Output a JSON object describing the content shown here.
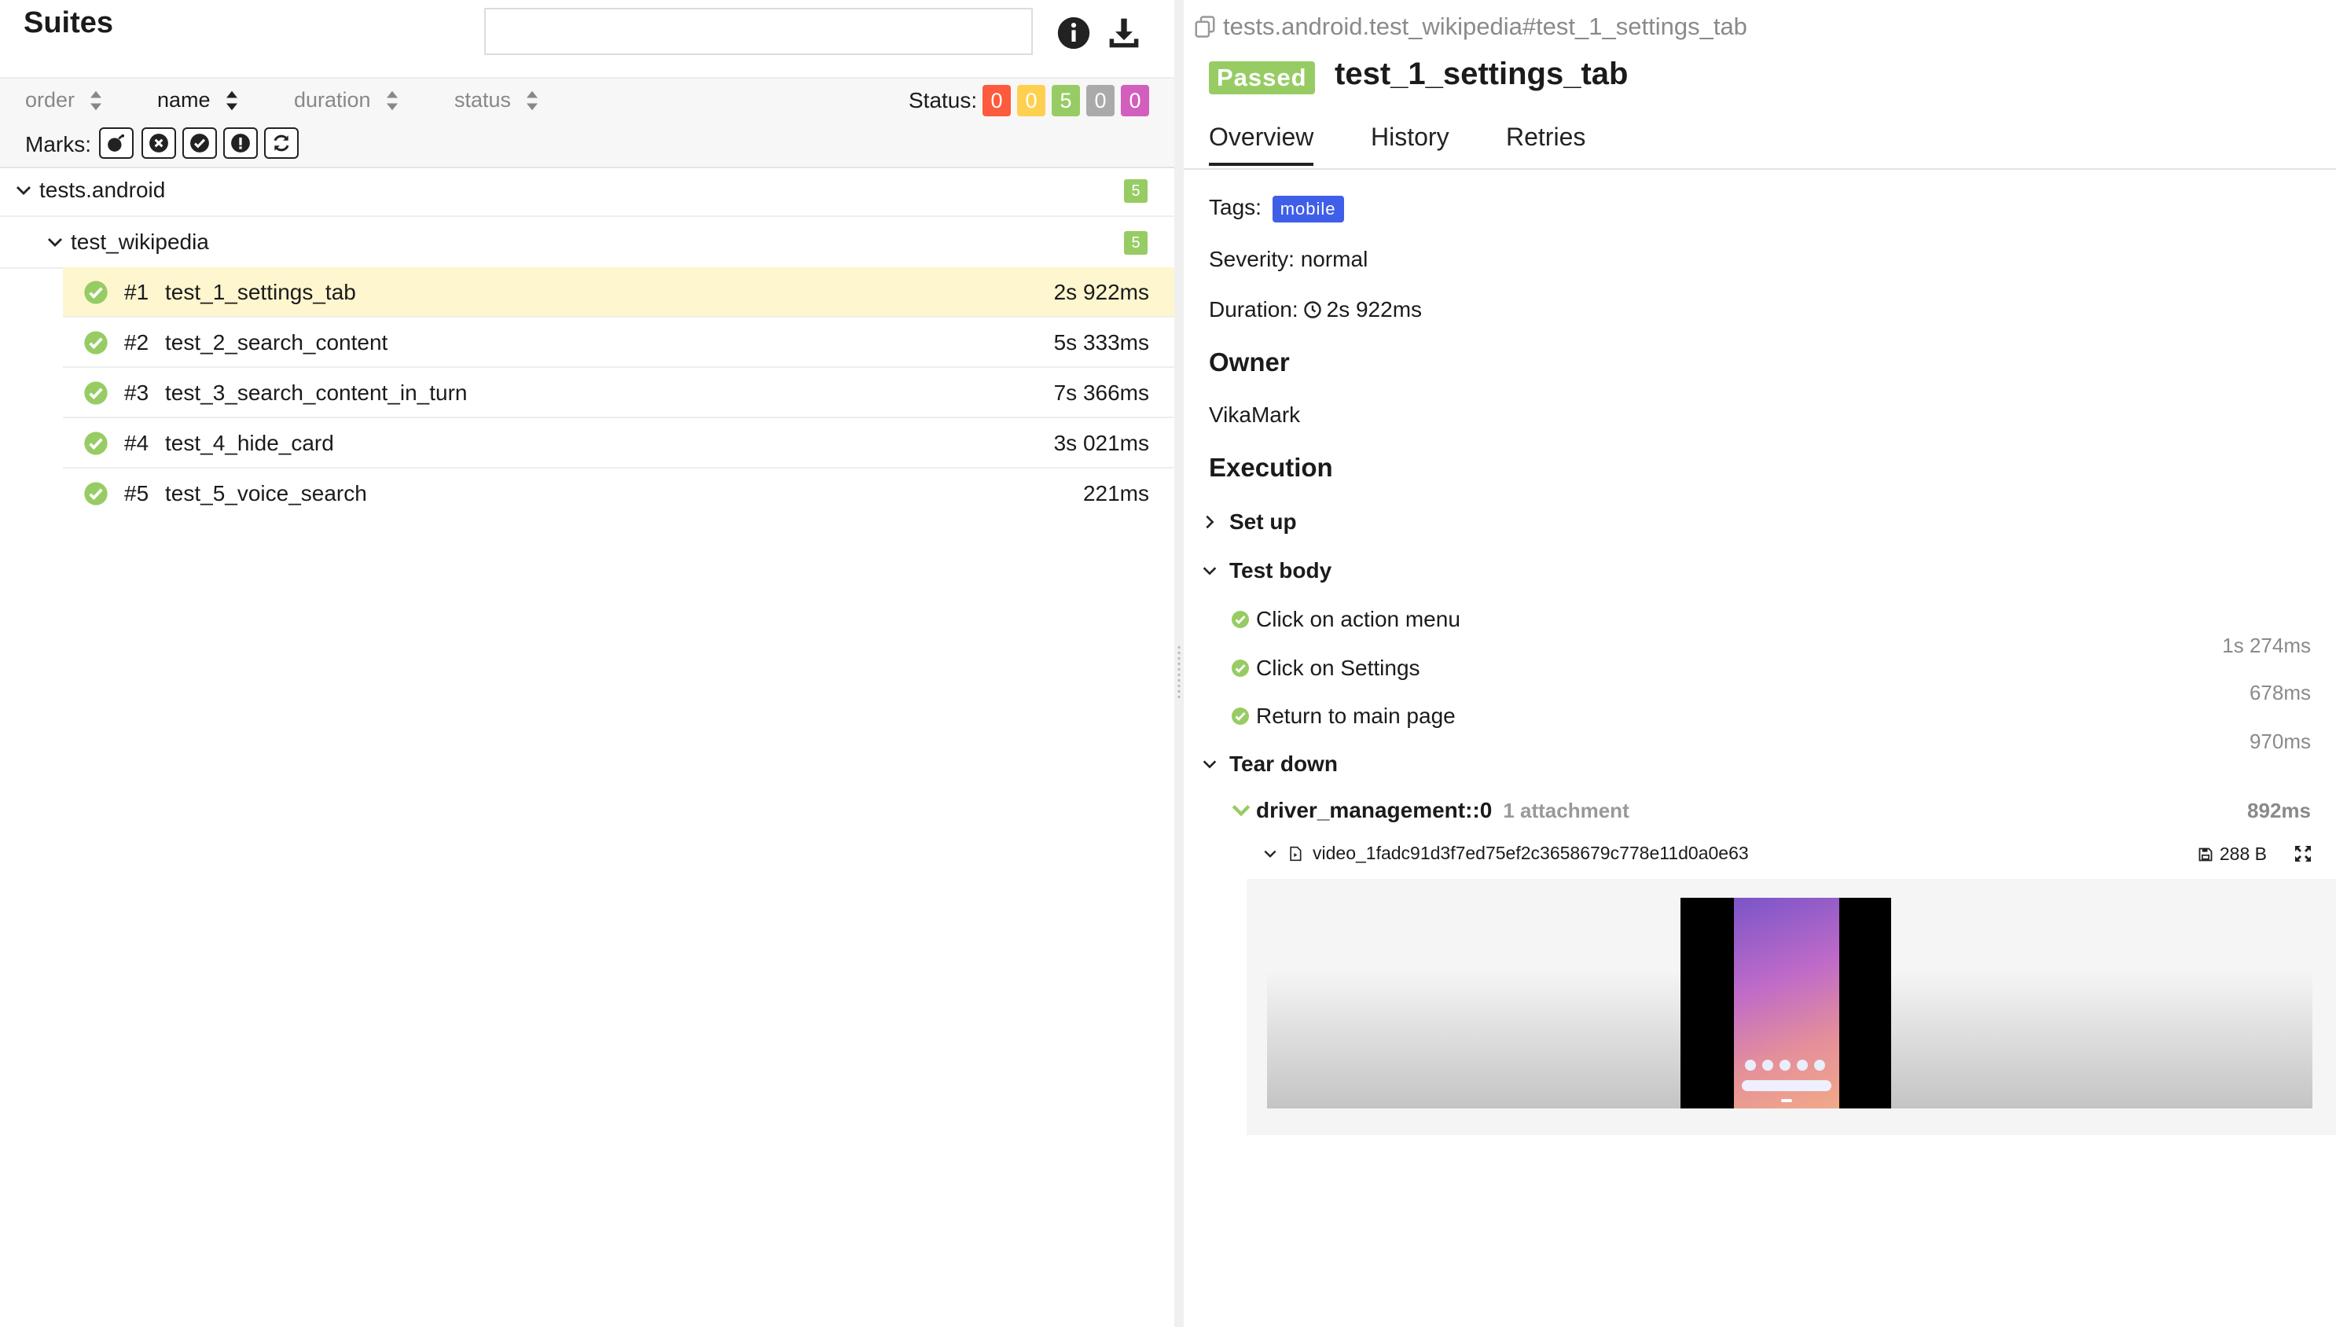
{
  "left": {
    "title": "Suites",
    "search_placeholder": "",
    "sort": {
      "order": "order",
      "name": "name",
      "duration": "duration",
      "status": "status"
    },
    "status_label": "Status:",
    "status_counts": [
      {
        "value": "0",
        "color": "#fd5a3e"
      },
      {
        "value": "0",
        "color": "#ffd050"
      },
      {
        "value": "5",
        "color": "#97cc64"
      },
      {
        "value": "0",
        "color": "#aaaaaa"
      },
      {
        "value": "0",
        "color": "#d35ebe"
      }
    ],
    "marks_label": "Marks:",
    "tree": {
      "root": {
        "name": "tests.android",
        "count": "5"
      },
      "group": {
        "name": "test_wikipedia",
        "count": "5"
      },
      "tests": [
        {
          "num": "#1",
          "name": "test_1_settings_tab",
          "duration": "2s 922ms"
        },
        {
          "num": "#2",
          "name": "test_2_search_content",
          "duration": "5s 333ms"
        },
        {
          "num": "#3",
          "name": "test_3_search_content_in_turn",
          "duration": "7s 366ms"
        },
        {
          "num": "#4",
          "name": "test_4_hide_card",
          "duration": "3s 021ms"
        },
        {
          "num": "#5",
          "name": "test_5_voice_search",
          "duration": "221ms"
        }
      ]
    }
  },
  "right": {
    "breadcrumb": "tests.android.test_wikipedia#test_1_settings_tab",
    "status_badge": "Passed",
    "test_title": "test_1_settings_tab",
    "tabs": [
      "Overview",
      "History",
      "Retries"
    ],
    "tags_label": "Tags:",
    "tag": "mobile",
    "severity": "Severity: normal",
    "duration_label": "Duration:",
    "duration_value": "2s 922ms",
    "owner_heading": "Owner",
    "owner": "VikaMark",
    "execution_heading": "Execution",
    "setup": "Set up",
    "test_body": "Test body",
    "steps": [
      {
        "name": "Click on action menu",
        "duration": "1s 274ms"
      },
      {
        "name": "Click on Settings",
        "duration": "678ms"
      },
      {
        "name": "Return to main page",
        "duration": "970ms"
      }
    ],
    "tear_down": "Tear down",
    "fixture": {
      "name": "driver_management::0",
      "attachments": "1 attachment",
      "duration": "892ms"
    },
    "attachment": {
      "name": "video_1fadc91d3f7ed75ef2c3658679c778e11d0a0e63",
      "size": "288 B"
    }
  }
}
